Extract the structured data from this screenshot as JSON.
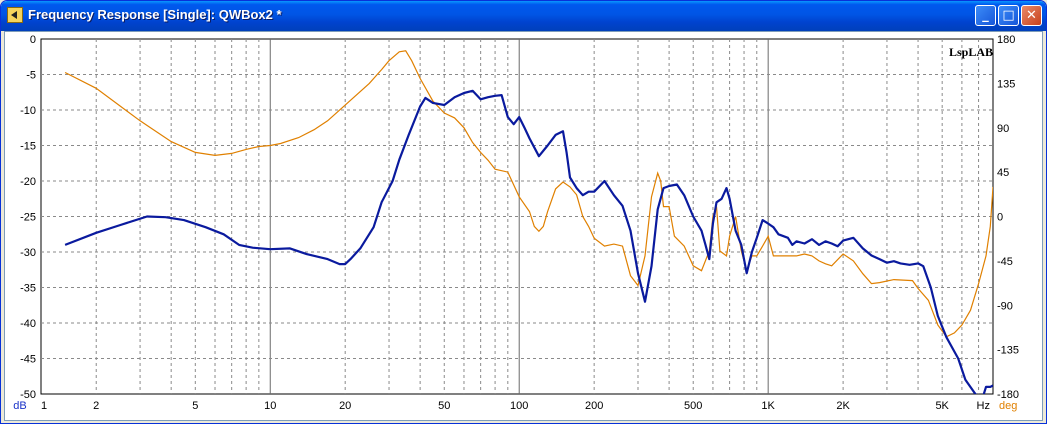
{
  "window": {
    "title": "Frequency Response [Single]: QWBox2 *",
    "buttons": {
      "minimize": "_",
      "maximize": "□",
      "close": "✕"
    }
  },
  "colors": {
    "magnitude": "#0a1a9e",
    "phase": "#e08000",
    "grid": "#8a8a8a",
    "major_grid": "#6a6a6a",
    "phase_label": "#e08000",
    "db_label": "#1a32c8"
  },
  "chart_data": {
    "type": "line",
    "watermark": "LspLAB",
    "x_scale": "log",
    "xlim": [
      1.2,
      8000
    ],
    "ylim": [
      -50,
      0
    ],
    "y2lim": [
      -180,
      180
    ],
    "x_ticks": [
      1,
      2,
      5,
      10,
      20,
      50,
      100,
      200,
      500,
      1000,
      2000,
      5000
    ],
    "x_tick_labels": [
      "1",
      "2",
      "5",
      "10",
      "20",
      "50",
      "100",
      "200",
      "500",
      "1K",
      "2K",
      "5K"
    ],
    "x_unit": "Hz",
    "y_ticks": [
      0,
      -5,
      -10,
      -15,
      -20,
      -25,
      -30,
      -35,
      -40,
      -45,
      -50
    ],
    "y_unit": "dB",
    "y2_ticks": [
      180,
      135,
      90,
      45,
      0,
      -45,
      -90,
      -135,
      -180
    ],
    "y2_unit": "deg",
    "grid": true,
    "series": [
      {
        "axis": "left",
        "points": [
          [
            1.5,
            -29
          ],
          [
            2,
            -27.3
          ],
          [
            2.5,
            -26.2
          ],
          [
            3.2,
            -25
          ],
          [
            3.8,
            -25.1
          ],
          [
            4.5,
            -25.5
          ],
          [
            5.5,
            -26.5
          ],
          [
            6.5,
            -27.5
          ],
          [
            7.5,
            -29
          ],
          [
            8.5,
            -29.4
          ],
          [
            10,
            -29.6
          ],
          [
            12,
            -29.5
          ],
          [
            14,
            -30.3
          ],
          [
            17,
            -31
          ],
          [
            19,
            -31.7
          ],
          [
            20,
            -31.7
          ],
          [
            21,
            -31
          ],
          [
            23,
            -29.5
          ],
          [
            26,
            -26.5
          ],
          [
            28,
            -23
          ],
          [
            31,
            -20
          ],
          [
            33,
            -17
          ],
          [
            36,
            -13.5
          ],
          [
            40,
            -9.5
          ],
          [
            42,
            -8.3
          ],
          [
            45,
            -9
          ],
          [
            50,
            -9.3
          ],
          [
            55,
            -8.2
          ],
          [
            60,
            -7.6
          ],
          [
            65,
            -7.3
          ],
          [
            70,
            -8.5
          ],
          [
            75,
            -8.2
          ],
          [
            80,
            -8
          ],
          [
            85,
            -7.9
          ],
          [
            90,
            -11
          ],
          [
            95,
            -12
          ],
          [
            100,
            -11
          ],
          [
            105,
            -12.5
          ],
          [
            110,
            -14
          ],
          [
            120,
            -16.5
          ],
          [
            130,
            -15
          ],
          [
            140,
            -13.5
          ],
          [
            150,
            -13
          ],
          [
            155,
            -16
          ],
          [
            160,
            -19.5
          ],
          [
            170,
            -21
          ],
          [
            180,
            -22
          ],
          [
            190,
            -21.5
          ],
          [
            200,
            -21.5
          ],
          [
            220,
            -20
          ],
          [
            240,
            -22
          ],
          [
            260,
            -23.5
          ],
          [
            280,
            -27
          ],
          [
            300,
            -33
          ],
          [
            320,
            -37
          ],
          [
            340,
            -32
          ],
          [
            360,
            -24
          ],
          [
            380,
            -21
          ],
          [
            400,
            -20.7
          ],
          [
            430,
            -20.5
          ],
          [
            460,
            -22
          ],
          [
            500,
            -25
          ],
          [
            540,
            -27
          ],
          [
            560,
            -29
          ],
          [
            580,
            -31
          ],
          [
            600,
            -26
          ],
          [
            620,
            -23
          ],
          [
            650,
            -22.5
          ],
          [
            680,
            -21
          ],
          [
            700,
            -22.5
          ],
          [
            740,
            -27
          ],
          [
            780,
            -29
          ],
          [
            820,
            -33
          ],
          [
            860,
            -30
          ],
          [
            900,
            -28
          ],
          [
            950,
            -25.5
          ],
          [
            1000,
            -26
          ],
          [
            1050,
            -26.5
          ],
          [
            1100,
            -27.5
          ],
          [
            1200,
            -28
          ],
          [
            1250,
            -29
          ],
          [
            1300,
            -28.5
          ],
          [
            1400,
            -28.8
          ],
          [
            1500,
            -28.2
          ],
          [
            1600,
            -29
          ],
          [
            1700,
            -28.5
          ],
          [
            1800,
            -28.8
          ],
          [
            1900,
            -29.2
          ],
          [
            2000,
            -28.4
          ],
          [
            2200,
            -28
          ],
          [
            2400,
            -29.5
          ],
          [
            2600,
            -30.5
          ],
          [
            2800,
            -31
          ],
          [
            3000,
            -31.5
          ],
          [
            3200,
            -31.3
          ],
          [
            3400,
            -31.6
          ],
          [
            3700,
            -31.8
          ],
          [
            4000,
            -31.6
          ],
          [
            4200,
            -32
          ],
          [
            4500,
            -35
          ],
          [
            4800,
            -39
          ],
          [
            5200,
            -42
          ],
          [
            5800,
            -45
          ],
          [
            6200,
            -48
          ],
          [
            6800,
            -50
          ],
          [
            7200,
            -51
          ],
          [
            7500,
            -49
          ],
          [
            7800,
            -49
          ],
          [
            8000,
            -48.8
          ]
        ]
      },
      {
        "axis": "right",
        "points": [
          [
            1.5,
            146
          ],
          [
            2,
            130
          ],
          [
            3,
            97
          ],
          [
            4,
            76
          ],
          [
            5,
            65
          ],
          [
            6,
            62
          ],
          [
            7,
            64
          ],
          [
            8,
            68
          ],
          [
            9,
            71
          ],
          [
            10,
            72
          ],
          [
            11,
            74
          ],
          [
            13,
            80
          ],
          [
            15,
            88
          ],
          [
            17,
            97
          ],
          [
            20,
            113
          ],
          [
            25,
            135
          ],
          [
            28,
            149
          ],
          [
            30,
            158
          ],
          [
            33,
            167
          ],
          [
            35,
            168
          ],
          [
            37,
            158
          ],
          [
            40,
            140
          ],
          [
            45,
            117
          ],
          [
            50,
            105
          ],
          [
            55,
            100
          ],
          [
            60,
            90
          ],
          [
            65,
            75
          ],
          [
            70,
            65
          ],
          [
            75,
            57
          ],
          [
            80,
            48
          ],
          [
            90,
            45
          ],
          [
            100,
            20
          ],
          [
            110,
            5
          ],
          [
            115,
            -10
          ],
          [
            120,
            -15
          ],
          [
            125,
            -10
          ],
          [
            130,
            5
          ],
          [
            140,
            28
          ],
          [
            150,
            35
          ],
          [
            160,
            30
          ],
          [
            170,
            22
          ],
          [
            180,
            0
          ],
          [
            190,
            -10
          ],
          [
            200,
            -22
          ],
          [
            220,
            -30
          ],
          [
            240,
            -28
          ],
          [
            260,
            -30
          ],
          [
            280,
            -60
          ],
          [
            300,
            -70
          ],
          [
            320,
            -40
          ],
          [
            340,
            20
          ],
          [
            360,
            44
          ],
          [
            370,
            36
          ],
          [
            380,
            10
          ],
          [
            400,
            10
          ],
          [
            420,
            -20
          ],
          [
            460,
            -30
          ],
          [
            500,
            -50
          ],
          [
            540,
            -55
          ],
          [
            580,
            -35
          ],
          [
            600,
            0
          ],
          [
            620,
            10
          ],
          [
            640,
            -35
          ],
          [
            680,
            -40
          ],
          [
            700,
            -20
          ],
          [
            740,
            0
          ],
          [
            780,
            -35
          ],
          [
            820,
            -55
          ],
          [
            860,
            -40
          ],
          [
            900,
            -40
          ],
          [
            950,
            -30
          ],
          [
            1000,
            -20
          ],
          [
            1050,
            -40
          ],
          [
            1100,
            -40
          ],
          [
            1200,
            -40
          ],
          [
            1300,
            -40
          ],
          [
            1400,
            -38
          ],
          [
            1500,
            -40
          ],
          [
            1600,
            -45
          ],
          [
            1700,
            -48
          ],
          [
            1800,
            -50
          ],
          [
            2000,
            -38
          ],
          [
            2200,
            -45
          ],
          [
            2400,
            -58
          ],
          [
            2600,
            -68
          ],
          [
            2800,
            -67
          ],
          [
            3200,
            -64
          ],
          [
            3800,
            -65
          ],
          [
            4000,
            -73
          ],
          [
            4400,
            -85
          ],
          [
            4800,
            -110
          ],
          [
            5200,
            -122
          ],
          [
            5600,
            -118
          ],
          [
            6000,
            -110
          ],
          [
            6500,
            -95
          ],
          [
            7000,
            -68
          ],
          [
            7500,
            -40
          ],
          [
            7800,
            -10
          ],
          [
            8000,
            30
          ]
        ]
      }
    ]
  }
}
